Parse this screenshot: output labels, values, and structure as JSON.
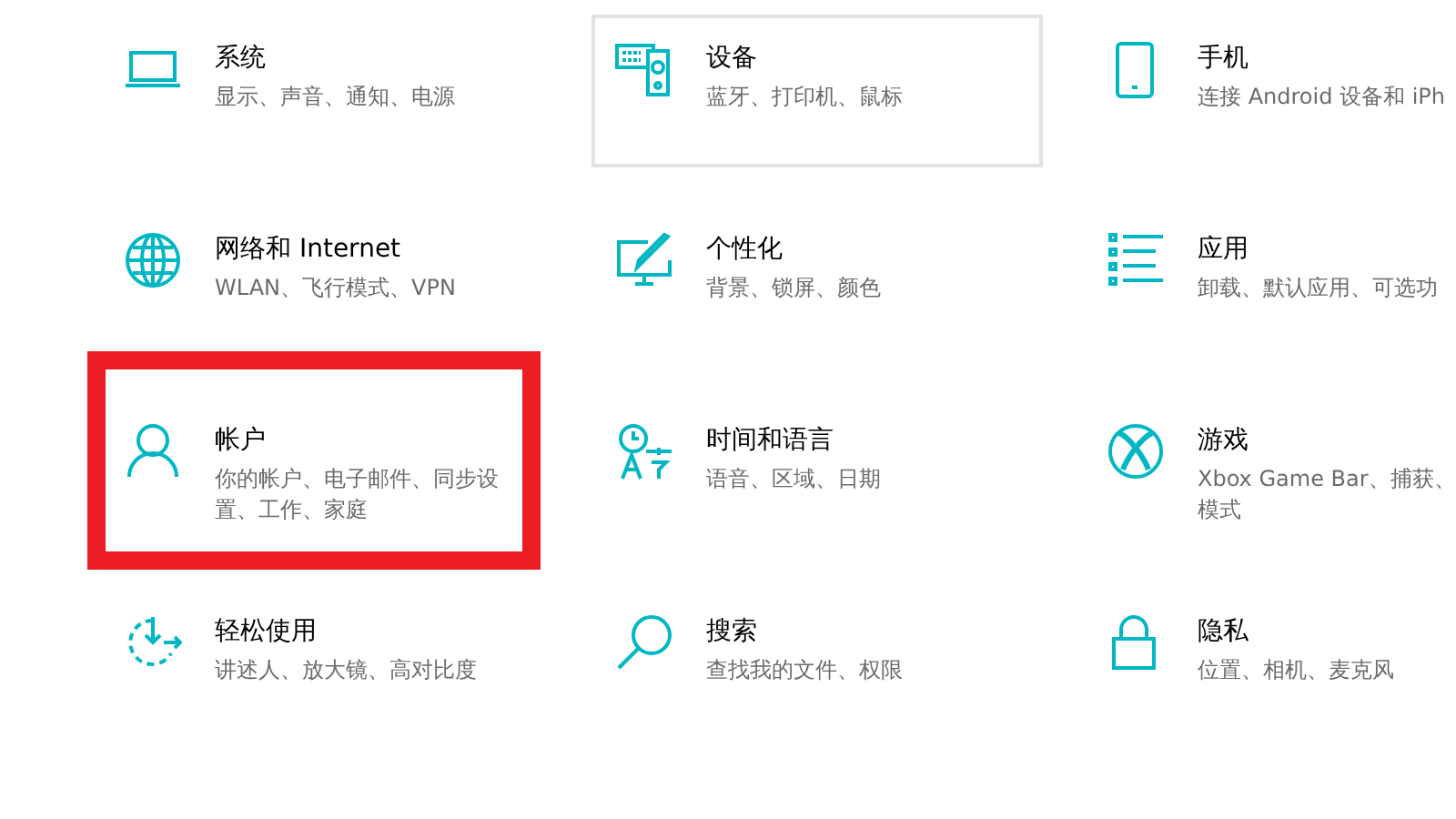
{
  "categories": [
    {
      "kind": "laptop",
      "title": "系统",
      "desc_lines": [
        "显示、声音、通知、电源"
      ],
      "hovered": false,
      "highlighted": false
    },
    {
      "kind": "keyboard",
      "title": "设备",
      "desc_lines": [
        "蓝牙、打印机、鼠标"
      ],
      "hovered": true,
      "highlighted": false
    },
    {
      "kind": "phone",
      "title": "手机",
      "desc_lines": [
        "连接 Android 设备和 iPh"
      ],
      "hovered": false,
      "highlighted": false
    },
    {
      "kind": "globe",
      "title": "网络和 Internet",
      "desc_lines": [
        "WLAN、飞行模式、VPN"
      ],
      "hovered": false,
      "highlighted": false
    },
    {
      "kind": "paint",
      "title": "个性化",
      "desc_lines": [
        "背景、锁屏、颜色"
      ],
      "hovered": false,
      "highlighted": false
    },
    {
      "kind": "list",
      "title": "应用",
      "desc_lines": [
        "卸载、默认应用、可选功"
      ],
      "hovered": false,
      "highlighted": false
    },
    {
      "kind": "person",
      "title": "帐户",
      "desc_lines": [
        "你的帐户、电子邮件、同步设",
        "置、工作、家庭"
      ],
      "hovered": false,
      "highlighted": true
    },
    {
      "kind": "language",
      "title": "时间和语言",
      "desc_lines": [
        "语音、区域、日期"
      ],
      "hovered": false,
      "highlighted": false
    },
    {
      "kind": "xbox",
      "title": "游戏",
      "desc_lines": [
        "Xbox Game Bar、捕获、",
        "模式"
      ],
      "hovered": false,
      "highlighted": false
    },
    {
      "kind": "ease",
      "title": "轻松使用",
      "desc_lines": [
        "讲述人、放大镜、高对比度"
      ],
      "hovered": false,
      "highlighted": false
    },
    {
      "kind": "search",
      "title": "搜索",
      "desc_lines": [
        "查找我的文件、权限"
      ],
      "hovered": false,
      "highlighted": false
    },
    {
      "kind": "lock",
      "title": "隐私",
      "desc_lines": [
        "位置、相机、麦克风"
      ],
      "hovered": false,
      "highlighted": false
    }
  ]
}
